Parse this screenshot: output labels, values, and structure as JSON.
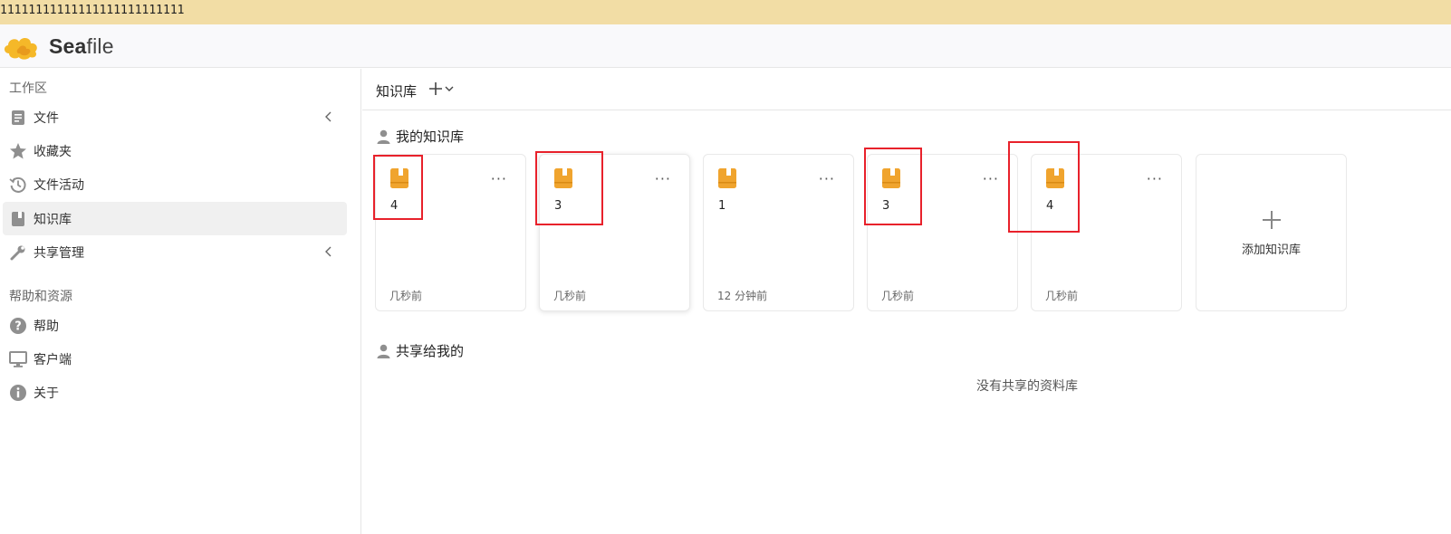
{
  "banner": {
    "text": "11111111111111111111111111"
  },
  "topbar": {
    "logo_text_bold": "Sea",
    "logo_text_rest": "file"
  },
  "sidebar": {
    "workspace_heading": "工作区",
    "items": [
      {
        "label": "文件",
        "icon": "file-icon"
      },
      {
        "label": "收藏夹",
        "icon": "star-icon"
      },
      {
        "label": "文件活动",
        "icon": "history-icon"
      },
      {
        "label": "知识库",
        "icon": "book-icon",
        "active": true
      },
      {
        "label": "共享管理",
        "icon": "wrench-icon"
      }
    ],
    "help_heading": "帮助和资源",
    "help_items": [
      {
        "label": "帮助",
        "icon": "question-icon"
      },
      {
        "label": "客户端",
        "icon": "monitor-icon"
      },
      {
        "label": "关于",
        "icon": "info-icon"
      }
    ]
  },
  "main": {
    "title": "知识库",
    "my_section_title": "我的知识库",
    "shared_section_title": "共享给我的",
    "empty_shared_message": "没有共享的资料库",
    "add_card_label": "添加知识库",
    "more_label": "···",
    "cards": [
      {
        "name": "4",
        "time": "几秒前"
      },
      {
        "name": "3",
        "time": "几秒前"
      },
      {
        "name": "1",
        "time": "12 分钟前"
      },
      {
        "name": "3",
        "time": "几秒前"
      },
      {
        "name": "4",
        "time": "几秒前"
      }
    ]
  },
  "colors": {
    "accent_orange": "#f0a42e",
    "highlight_red": "#e8212b",
    "banner_bg": "#f2dda5"
  }
}
